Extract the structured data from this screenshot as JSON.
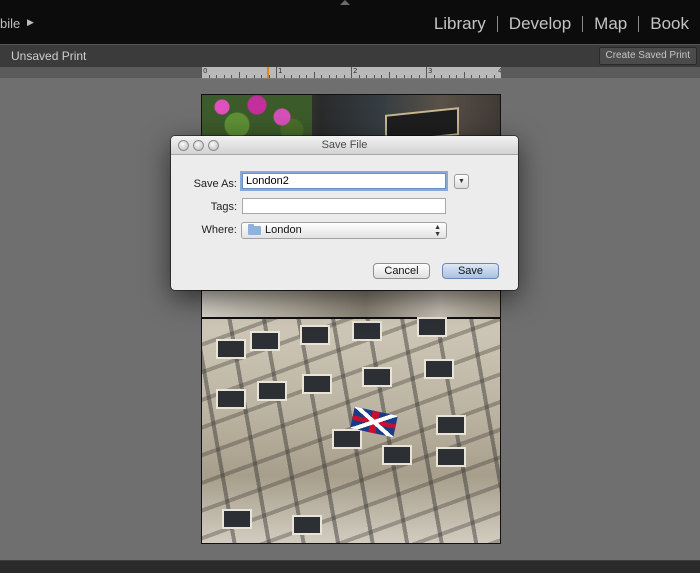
{
  "topbar": {
    "left_label": "bile",
    "play_icon": "play-triangle-icon",
    "modules": [
      {
        "label": "Library"
      },
      {
        "label": "Develop"
      },
      {
        "label": "Map"
      },
      {
        "label": "Book"
      }
    ]
  },
  "toolbar": {
    "title": "Unsaved Print",
    "create_saved_print": "Create Saved Print"
  },
  "ruler": {
    "numbers": [
      "0",
      "1",
      "2",
      "3",
      "4"
    ]
  },
  "dialog": {
    "title": "Save File",
    "save_as_label": "Save As:",
    "save_as_value": "London2",
    "tags_label": "Tags:",
    "tags_value": "",
    "where_label": "Where:",
    "where_value": "London",
    "cancel_label": "Cancel",
    "save_label": "Save"
  },
  "colors": {
    "background": "#6f6f6f",
    "topbar": "#0c0c0c",
    "dialog": "#ececec",
    "focus_ring": "#8aaad6",
    "ruler_marker": "#d88a1c"
  }
}
